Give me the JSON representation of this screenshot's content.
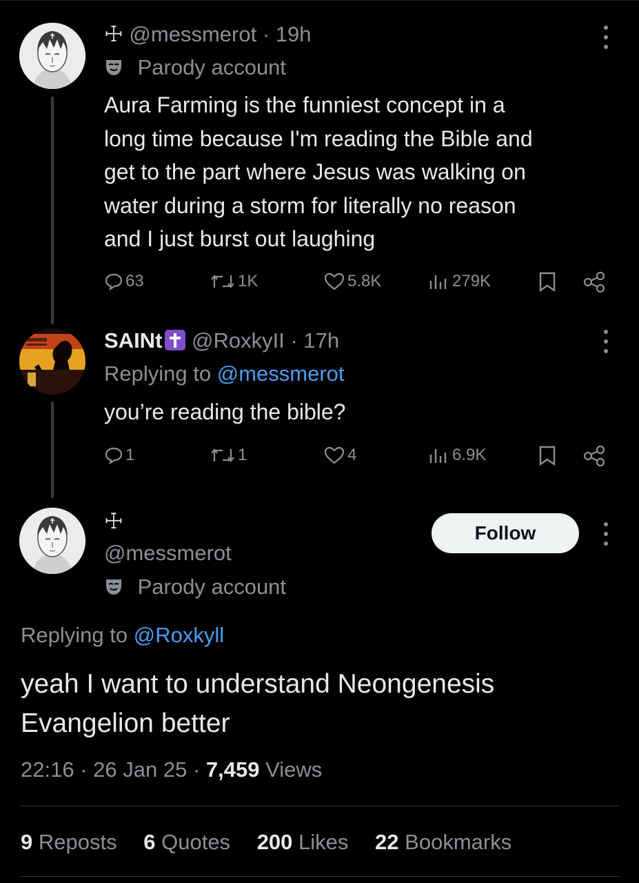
{
  "posts": [
    {
      "handle": "@messmerot",
      "time": "19h",
      "separator": "·",
      "cross": "☩",
      "label": "Parody account",
      "text_lines": [
        "Aura Farming is the funniest concept in a",
        "long time because I'm reading the Bible and",
        "get to the part where Jesus was walking on",
        "water during a storm for literally no reason",
        "and I just burst out laughing"
      ],
      "replies": "63",
      "reposts": "1K",
      "likes": "5.8K",
      "views": "279K"
    },
    {
      "display_name": "SAINt",
      "handle": "@RoxkyII",
      "time": "17h",
      "separator": "·",
      "replying_prefix": "Replying to ",
      "replying_to": "@messmerot",
      "text": "you’re reading the bible?",
      "replies": "1",
      "reposts": "1",
      "likes": "4",
      "views": "6.9K"
    }
  ],
  "main": {
    "cross": "☩",
    "handle": "@messmerot",
    "label": "Parody account",
    "follow_label": "Follow",
    "replying_prefix": "Replying to ",
    "replying_to": "@Roxkyll",
    "text_lines": [
      "yeah I want to understand Neongenesis",
      "Evangelion better"
    ],
    "time": "22:16",
    "date": "26 Jan 25",
    "separator": "·",
    "views_count": "7,459",
    "views_label": "Views",
    "reposts_count": "9",
    "reposts_label": "Reposts",
    "quotes_count": "6",
    "quotes_label": "Quotes",
    "likes_count": "200",
    "likes_label": "Likes",
    "bookmarks_count": "22",
    "bookmarks_label": "Bookmarks"
  },
  "colors": {
    "background": "#000000",
    "text": "#e7e9ea",
    "muted": "#8b9096",
    "link": "#4b9cf0",
    "follow_bg": "#eff3f4",
    "emoji_purple": "#7f4fc9"
  },
  "icons": [
    "reply-icon",
    "repost-icon",
    "like-icon",
    "views-icon",
    "bookmark-icon",
    "share-icon",
    "more-icon",
    "parody-mask-icon"
  ]
}
